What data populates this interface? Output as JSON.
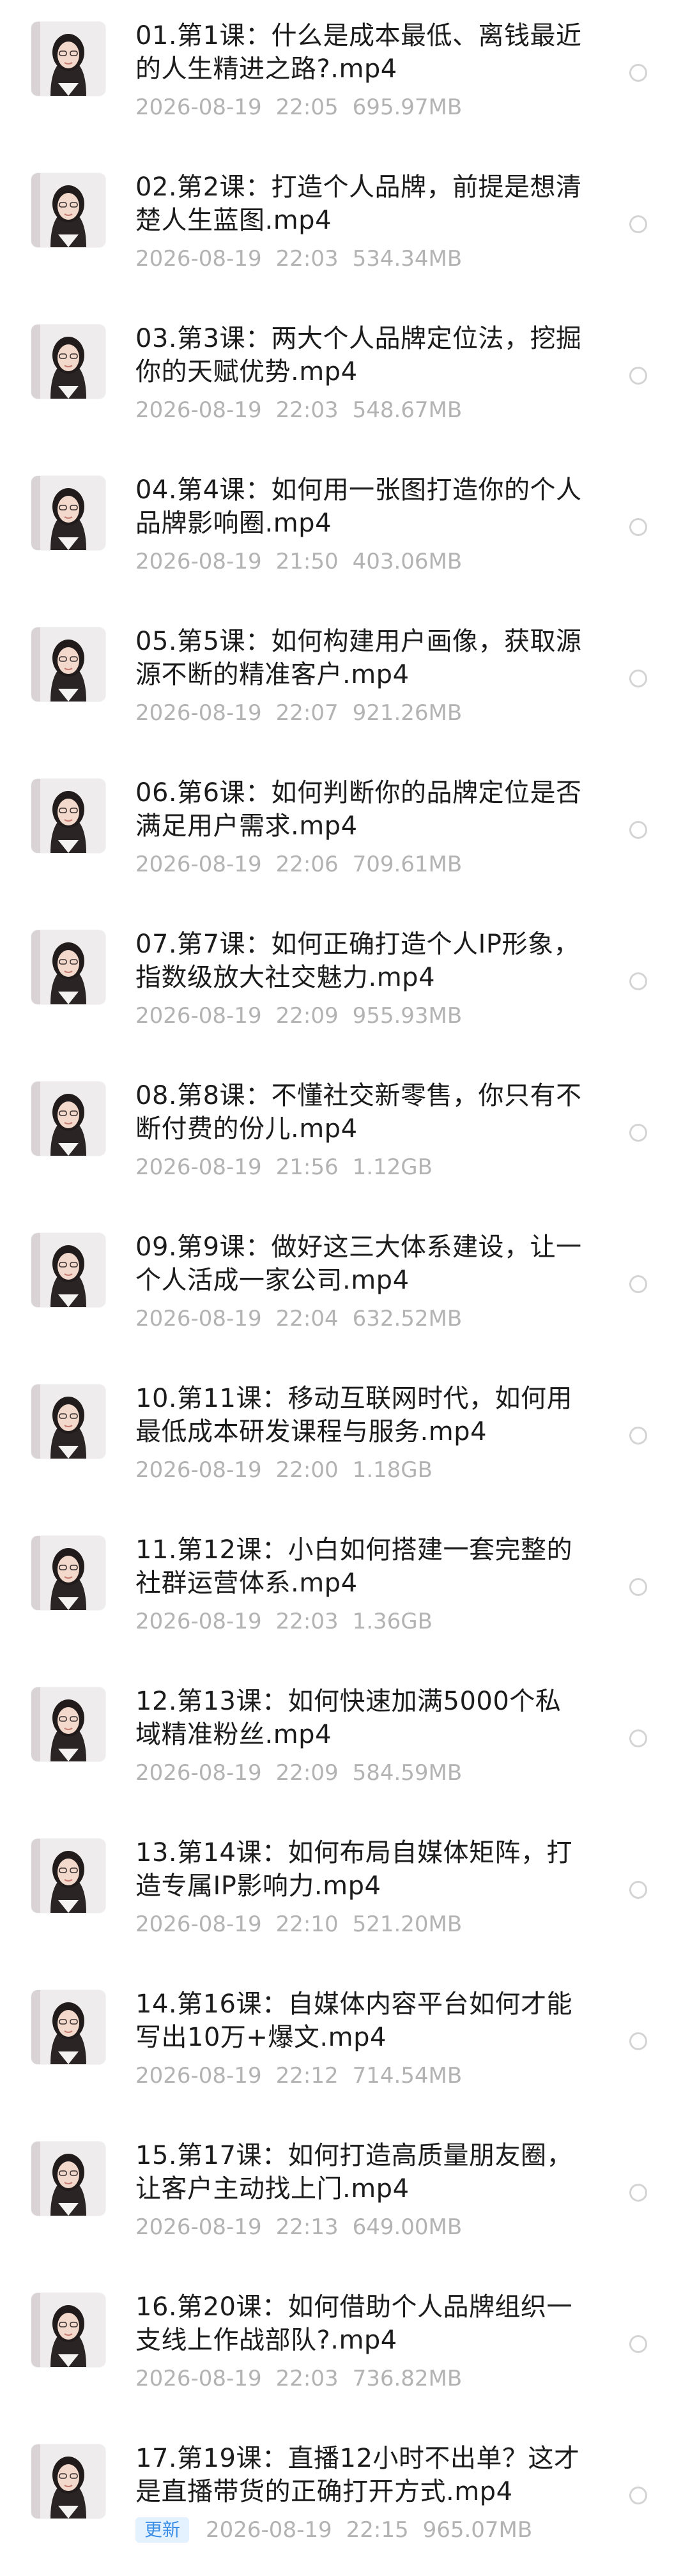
{
  "files": [
    {
      "title": "01.第1课：什么是成本最低、离钱最近的人生精进之路?.mp4",
      "date": "2026-08-19",
      "time": "22:05",
      "size": "695.97MB"
    },
    {
      "title": "02.第2课：打造个人品牌，前提是想清楚人生蓝图.mp4",
      "date": "2026-08-19",
      "time": "22:03",
      "size": "534.34MB"
    },
    {
      "title": "03.第3课：两大个人品牌定位法，挖掘你的天赋优势.mp4",
      "date": "2026-08-19",
      "time": "22:03",
      "size": "548.67MB"
    },
    {
      "title": "04.第4课：如何用一张图打造你的个人品牌影响圈.mp4",
      "date": "2026-08-19",
      "time": "21:50",
      "size": "403.06MB"
    },
    {
      "title": "05.第5课：如何构建用户画像，获取源源不断的精准客户.mp4",
      "date": "2026-08-19",
      "time": "22:07",
      "size": "921.26MB"
    },
    {
      "title": "06.第6课：如何判断你的品牌定位是否满足用户需求.mp4",
      "date": "2026-08-19",
      "time": "22:06",
      "size": "709.61MB"
    },
    {
      "title": "07.第7课：如何正确打造个人IP形象，指数级放大社交魅力.mp4",
      "date": "2026-08-19",
      "time": "22:09",
      "size": "955.93MB"
    },
    {
      "title": "08.第8课：不懂社交新零售，你只有不断付费的份儿.mp4",
      "date": "2026-08-19",
      "time": "21:56",
      "size": "1.12GB"
    },
    {
      "title": "09.第9课：做好这三大体系建设，让一个人活成一家公司.mp4",
      "date": "2026-08-19",
      "time": "22:04",
      "size": "632.52MB"
    },
    {
      "title": "10.第11课：移动互联网时代，如何用最低成本研发课程与服务.mp4",
      "date": "2026-08-19",
      "time": "22:00",
      "size": "1.18GB"
    },
    {
      "title": "11.第12课：小白如何搭建一套完整的社群运营体系.mp4",
      "date": "2026-08-19",
      "time": "22:03",
      "size": "1.36GB"
    },
    {
      "title": "12.第13课：如何快速加满5000个私域精准粉丝.mp4",
      "date": "2026-08-19",
      "time": "22:09",
      "size": "584.59MB"
    },
    {
      "title": "13.第14课：如何布局自媒体矩阵，打造专属IP影响力.mp4",
      "date": "2026-08-19",
      "time": "22:10",
      "size": "521.20MB"
    },
    {
      "title": "14.第16课：自媒体内容平台如何才能写出10万+爆文.mp4",
      "date": "2026-08-19",
      "time": "22:12",
      "size": "714.54MB"
    },
    {
      "title": "15.第17课：如何打造高质量朋友圈，让客户主动找上门.mp4",
      "date": "2026-08-19",
      "time": "22:13",
      "size": "649.00MB"
    },
    {
      "title": "16.第20课：如何借助个人品牌组织一支线上作战部队?.mp4",
      "date": "2026-08-19",
      "time": "22:03",
      "size": "736.82MB"
    },
    {
      "title": "17.第19课：直播12小时不出单？这才是直播带货的正确打开方式.mp4",
      "date": "2026-08-19",
      "time": "22:15",
      "size": "965.07MB",
      "badge": "更新"
    }
  ],
  "colors": {
    "title": "#1c1c1c",
    "meta": "#b3b3b3",
    "badge_bg": "#e4f1ff",
    "badge_text": "#3a8ee6"
  }
}
